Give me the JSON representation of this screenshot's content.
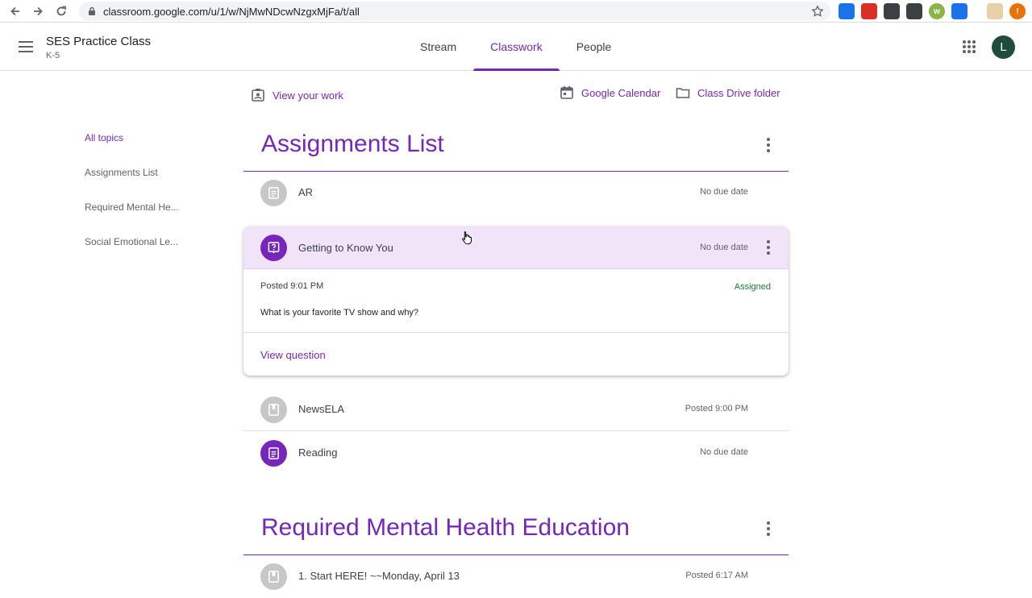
{
  "browser": {
    "url": "classroom.google.com/u/1/w/NjMwNDcwNzgxMjFa/t/all",
    "extensions": [
      {
        "icon": "link-ext-icon",
        "color": "#1a73e8",
        "glyph": ""
      },
      {
        "icon": "record-ext-icon",
        "color": "#d93025",
        "glyph": ""
      },
      {
        "icon": "shield-ext-icon",
        "color": "#3c4043",
        "glyph": ""
      },
      {
        "icon": "shield-check-ext-icon",
        "color": "#3c4043",
        "glyph": ""
      },
      {
        "icon": "w-ext-icon",
        "color": "#8ab34a",
        "glyph": "w"
      },
      {
        "icon": "blue-ext-icon",
        "color": "#1a73e8",
        "glyph": ""
      },
      {
        "icon": "puzzle-ext-icon",
        "color": "#e8d0a9",
        "glyph": ""
      },
      {
        "icon": "alert-ext-icon",
        "color": "#e8710a",
        "glyph": "!"
      }
    ]
  },
  "header": {
    "class_name": "SES Practice Class",
    "section": "K-5",
    "tabs": [
      {
        "label": "Stream",
        "active": false
      },
      {
        "label": "Classwork",
        "active": true
      },
      {
        "label": "People",
        "active": false
      }
    ],
    "avatar_initial": "L",
    "accent_color": "#7627bb"
  },
  "toolbar": {
    "view_work": "View your work",
    "calendar": "Google Calendar",
    "drive": "Class Drive folder"
  },
  "sidebar": {
    "items": [
      {
        "label": "All topics",
        "active": true
      },
      {
        "label": "Assignments List",
        "active": false
      },
      {
        "label": "Required Mental He...",
        "active": false
      },
      {
        "label": "Social Emotional Le...",
        "active": false
      }
    ]
  },
  "topics": [
    {
      "title": "Assignments List",
      "items": [
        {
          "title": "AR",
          "meta": "No due date",
          "icon": "assignment-icon",
          "state": "gray"
        },
        {
          "title": "Getting to Know You",
          "meta": "No due date",
          "icon": "question-icon",
          "state": "purple",
          "expanded": true,
          "posted": "Posted 9:01 PM",
          "status": "Assigned",
          "description": "What is your favorite TV show and why?",
          "action": "View question"
        },
        {
          "title": "NewsELA",
          "meta": "Posted 9:00 PM",
          "icon": "material-icon",
          "state": "gray"
        },
        {
          "title": "Reading",
          "meta": "No due date",
          "icon": "assignment-icon",
          "state": "purple"
        }
      ]
    },
    {
      "title": "Required Mental Health Education",
      "items": [
        {
          "title": "1. Start HERE! ~~Monday, April 13",
          "meta": "Posted 6:17 AM",
          "icon": "material-icon",
          "state": "gray"
        }
      ]
    }
  ]
}
